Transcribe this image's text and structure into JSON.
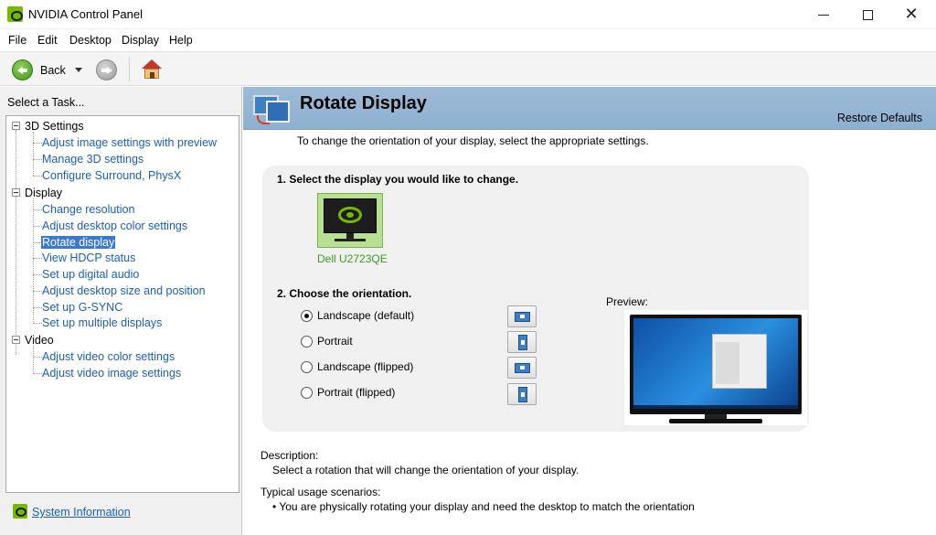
{
  "window": {
    "title": "NVIDIA Control Panel",
    "icons": {
      "app": "nvidia-logo-icon",
      "minimize": "minimize-icon",
      "maximize": "maximize-icon",
      "close": "close-icon"
    }
  },
  "menubar": {
    "items": [
      "File",
      "Edit",
      "Desktop",
      "Display",
      "Help"
    ]
  },
  "toolbar": {
    "back_label": "Back",
    "icons": {
      "back": "back-arrow-icon",
      "forward": "forward-arrow-icon",
      "home": "home-icon"
    }
  },
  "sidebar": {
    "header": "Select a Task...",
    "categories": [
      {
        "label": "3D Settings",
        "tasks": [
          "Adjust image settings with preview",
          "Manage 3D settings",
          "Configure Surround, PhysX"
        ]
      },
      {
        "label": "Display",
        "tasks": [
          "Change resolution",
          "Adjust desktop color settings",
          "Rotate display",
          "View HDCP status",
          "Set up digital audio",
          "Adjust desktop size and position",
          "Set up G-SYNC",
          "Set up multiple displays"
        ]
      },
      {
        "label": "Video",
        "tasks": [
          "Adjust video color settings",
          "Adjust video image settings"
        ]
      }
    ],
    "selected_task": "Rotate display",
    "system_info_label": "System Information"
  },
  "main": {
    "title": "Rotate Display",
    "restore_defaults": "Restore Defaults",
    "intro": "To change the orientation of your display, select the appropriate settings.",
    "step1_label": "1. Select the display you would like to change.",
    "display_name": "Dell U2723QE",
    "step2_label": "2. Choose the orientation.",
    "orientations": [
      {
        "label": "Landscape (default)",
        "selected": true,
        "icon": "landscape-icon"
      },
      {
        "label": "Portrait",
        "selected": false,
        "icon": "portrait-icon"
      },
      {
        "label": "Landscape (flipped)",
        "selected": false,
        "icon": "landscape-flipped-icon"
      },
      {
        "label": "Portrait (flipped)",
        "selected": false,
        "icon": "portrait-flipped-icon"
      }
    ],
    "preview_label": "Preview:",
    "description_heading": "Description:",
    "description_text": "Select a rotation that will change the orientation of your display.",
    "usage_heading": "Typical usage scenarios:",
    "usage_text": "• You are physically rotating your display and need the desktop to match the orientation"
  },
  "colors": {
    "accent_green": "#76b900",
    "link_blue": "#1c5fb8",
    "selection_blue": "#3a78d8",
    "header_blue": "#9dbbd7"
  }
}
